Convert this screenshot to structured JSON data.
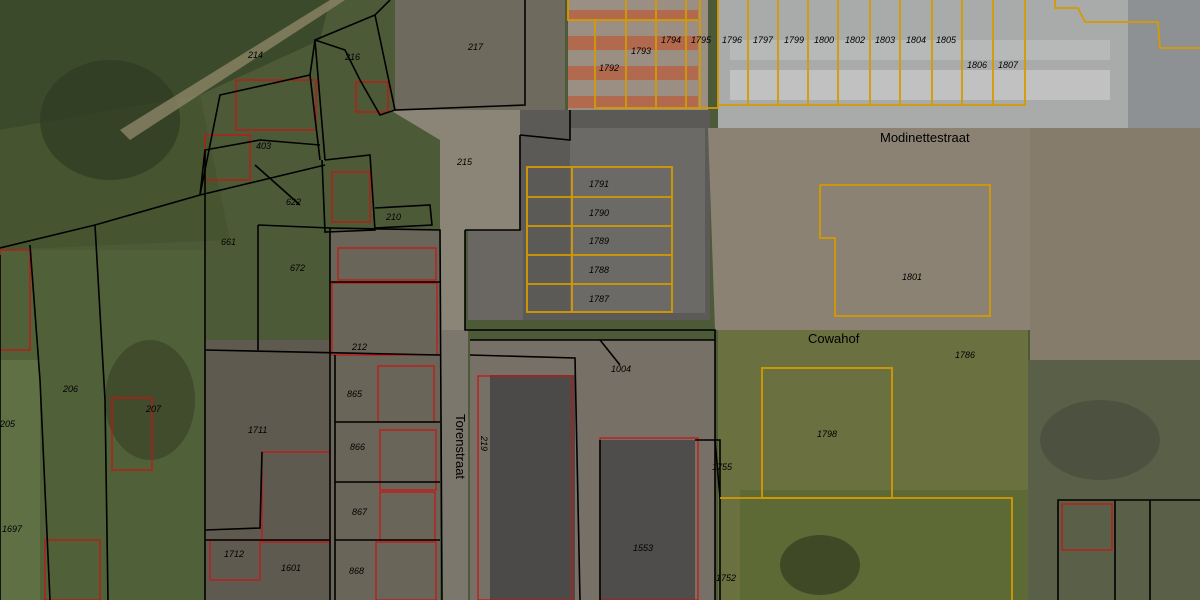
{
  "map": {
    "colors": {
      "cadastral_line": "#000000",
      "selected_parcel_line": "#d69a00",
      "building_outline": "#cc1111",
      "label_text": "#000000"
    },
    "streets": [
      {
        "id": "modinettestraat",
        "name": "Modinettestraat"
      },
      {
        "id": "cowahof",
        "name": "Cowahof"
      },
      {
        "id": "torenstraat",
        "name": "Torenstraat"
      }
    ],
    "parcels": [
      "214",
      "216",
      "217",
      "403",
      "215",
      "622",
      "210",
      "661",
      "672",
      "212",
      "1004",
      "206",
      "207",
      "205",
      "865",
      "1711",
      "866",
      "219",
      "867",
      "1697",
      "1712",
      "1601",
      "868",
      "1553",
      "1755",
      "1752",
      "1792",
      "1793",
      "1794",
      "1795",
      "1796",
      "1797",
      "1799",
      "1800",
      "1802",
      "1803",
      "1804",
      "1805",
      "1806",
      "1807",
      "1791",
      "1790",
      "1789",
      "1788",
      "1787",
      "1801",
      "1786",
      "1798"
    ]
  }
}
